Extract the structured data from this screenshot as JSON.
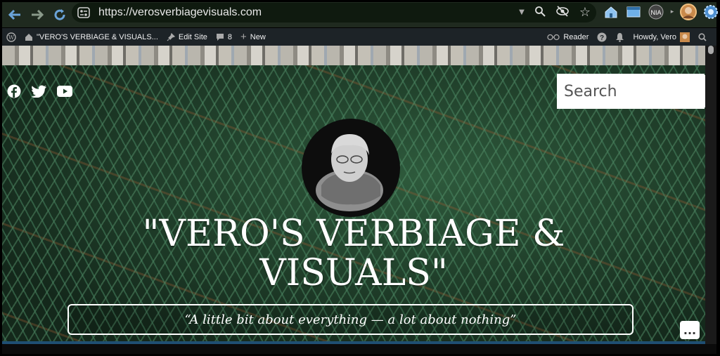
{
  "browser": {
    "url": "https://verosverbiagevisuals.com",
    "icons": [
      "back-icon",
      "forward-icon",
      "reload-icon",
      "site-info-icon",
      "zoom-icon",
      "eye-slash-icon",
      "star-icon",
      "home-icon",
      "tab-icon",
      "extension-icon",
      "profile-avatar",
      "gear-icon"
    ]
  },
  "adminbar": {
    "site_name": "\"VERO'S VERBIAGE & VISUALS...",
    "edit_site": "Edit Site",
    "comments_count": "8",
    "new_label": "New",
    "reader_label": "Reader",
    "howdy": "Howdy, Vero"
  },
  "header": {
    "search_placeholder": "Search",
    "site_title": "\"VERO'S VERBIAGE & VISUALS\"",
    "tagline": "“A little bit about everything — a lot about nothing”",
    "more_label": "..."
  },
  "colors": {
    "accent_blue": "#1f4f73",
    "admin_bar": "#1d2327",
    "toolbar": "#1f2a1f"
  }
}
